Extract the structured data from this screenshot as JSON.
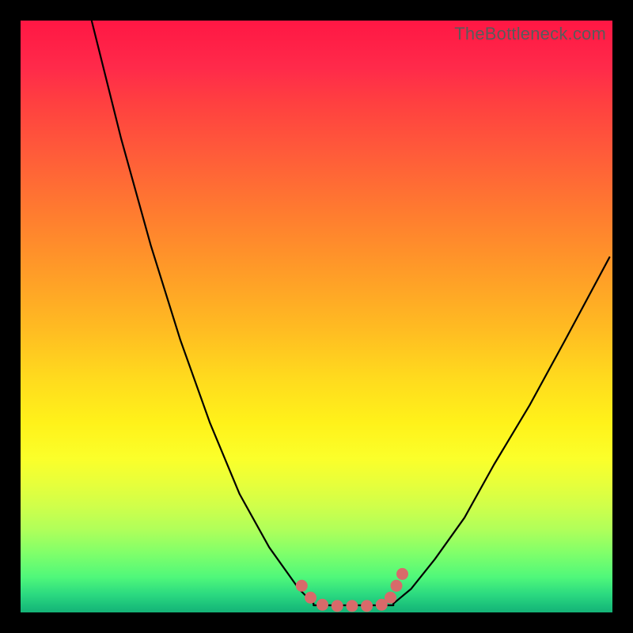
{
  "watermark": "TheBottleneck.com",
  "colors": {
    "frame": "#000000",
    "curve_stroke": "#000000",
    "marker_fill": "#d86a6a",
    "marker_stroke": "#c85a5a"
  },
  "chart_data": {
    "type": "line",
    "title": "",
    "xlabel": "",
    "ylabel": "",
    "xlim": [
      0,
      100
    ],
    "ylim": [
      0,
      100
    ],
    "note": "Axes are implicit percent scales; y is inverted (0 at bottom). Values estimated from pixel positions.",
    "series": [
      {
        "name": "left-branch",
        "x": [
          12,
          17,
          22,
          27,
          32,
          37,
          42,
          47,
          49.5
        ],
        "y": [
          100,
          80,
          62,
          46,
          32,
          20,
          11,
          4,
          1.5
        ]
      },
      {
        "name": "right-branch",
        "x": [
          63,
          66,
          70,
          75,
          80,
          86,
          92,
          99.5
        ],
        "y": [
          1.5,
          4,
          9,
          16,
          25,
          35,
          46,
          60
        ]
      },
      {
        "name": "floor",
        "x": [
          49.5,
          63
        ],
        "y": [
          1.2,
          1.2
        ]
      }
    ],
    "markers": {
      "name": "highlight-dots",
      "x": [
        47.5,
        49,
        51,
        53.5,
        56,
        58.5,
        61,
        62.5,
        63.5,
        64.5
      ],
      "y": [
        4.5,
        2.5,
        1.3,
        1.1,
        1.1,
        1.1,
        1.3,
        2.5,
        4.5,
        6.5
      ]
    }
  }
}
